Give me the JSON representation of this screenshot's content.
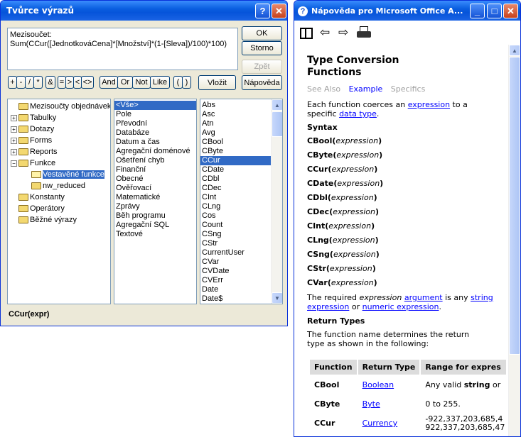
{
  "builder": {
    "title": "Tvůrce výrazů",
    "help_btn": "?",
    "close_btn": "✕",
    "expression_lines": [
      "Mezisoučet:",
      "Sum(CCur([JednotkováCena]*[Množství]*(1-[Sleva])/100)*100)"
    ],
    "ok": "OK",
    "cancel": "Storno",
    "undo": "Zpět",
    "operators": [
      "+",
      "-",
      "/",
      "*",
      "&",
      "=",
      ">",
      "<",
      "<>",
      "And",
      "Or",
      "Not",
      "Like",
      "(",
      ")"
    ],
    "insert": "Vložit",
    "help": "Nápověda",
    "folders": [
      {
        "label": "Mezisoučty objednávek",
        "indent": 0,
        "expander": "",
        "icon": "folder"
      },
      {
        "label": "Tabulky",
        "indent": 0,
        "expander": "+",
        "icon": "folder"
      },
      {
        "label": "Dotazy",
        "indent": 0,
        "expander": "+",
        "icon": "folder"
      },
      {
        "label": "Forms",
        "indent": 0,
        "expander": "+",
        "icon": "folder"
      },
      {
        "label": "Reports",
        "indent": 0,
        "expander": "+",
        "icon": "folder"
      },
      {
        "label": "Funkce",
        "indent": 0,
        "expander": "-",
        "icon": "folder"
      },
      {
        "label": "Vestavěné funkce",
        "indent": 1,
        "expander": "",
        "icon": "open-folder",
        "selected": true
      },
      {
        "label": "nw_reduced",
        "indent": 1,
        "expander": "",
        "icon": "folder"
      },
      {
        "label": "Konstanty",
        "indent": 0,
        "expander": "",
        "icon": "folder"
      },
      {
        "label": "Operátory",
        "indent": 0,
        "expander": "",
        "icon": "folder"
      },
      {
        "label": "Běžné výrazy",
        "indent": 0,
        "expander": "",
        "icon": "folder"
      }
    ],
    "categories": [
      "<Vše>",
      "Pole",
      "Převodní",
      "Databáze",
      "Datum a čas",
      "Agregační doménové",
      "Ošetření chyb",
      "Finanční",
      "Obecné",
      "Ověřovací",
      "Matematické",
      "Zprávy",
      "Běh programu",
      "Agregační SQL",
      "Textové"
    ],
    "category_selected": 0,
    "functions": [
      "Abs",
      "Asc",
      "Atn",
      "Avg",
      "CBool",
      "CByte",
      "CCur",
      "CDate",
      "CDbl",
      "CDec",
      "CInt",
      "CLng",
      "Cos",
      "Count",
      "CSng",
      "CStr",
      "CurrentUser",
      "CVar",
      "CVDate",
      "CVErr",
      "Date",
      "Date$"
    ],
    "function_selected": 6,
    "status": "CCur(expr)"
  },
  "help": {
    "title": "Nápověda pro Microsoft Office A...",
    "min_btn": "_",
    "max_btn": "□",
    "close_btn": "✕",
    "heading": [
      "Type Conversion",
      "Functions"
    ],
    "tabs": [
      "See Also",
      "Example",
      "Specifics"
    ],
    "intro_parts": [
      "Each function coerces an ",
      "expression",
      " to a specific ",
      "data type",
      "."
    ],
    "syntax_title": "Syntax",
    "syntax": [
      {
        "name": "CBool",
        "arg": "expression"
      },
      {
        "name": "CByte",
        "arg": "expression"
      },
      {
        "name": "CCur",
        "arg": "expression"
      },
      {
        "name": "CDate",
        "arg": "expression"
      },
      {
        "name": "CDbl",
        "arg": "expression"
      },
      {
        "name": "CDec",
        "arg": "expression"
      },
      {
        "name": "CInt",
        "arg": "expression"
      },
      {
        "name": "CLng",
        "arg": "expression"
      },
      {
        "name": "CSng",
        "arg": "expression"
      },
      {
        "name": "CStr",
        "arg": "expression"
      },
      {
        "name": "CVar",
        "arg": "expression"
      }
    ],
    "required_parts": [
      "The required ",
      "expression",
      " ",
      "argument",
      " is any ",
      "string expression",
      " or ",
      "numeric expression",
      "."
    ],
    "return_title": "Return Types",
    "return_text": "The function name determines the return type as shown in the following:",
    "table_headers": [
      "Function",
      "Return Type",
      "Range for expres"
    ],
    "table_rows": [
      {
        "fn": "CBool",
        "type": "Boolean",
        "range_pre": "Any valid ",
        "range_bold": "string",
        "range_post": " or"
      },
      {
        "fn": "CByte",
        "type": "Byte",
        "range_pre": "0 to 255.",
        "range_bold": "",
        "range_post": ""
      },
      {
        "fn": "CCur",
        "type": "Currency",
        "range_pre": "-922,337,203,685,4",
        "range_bold": "",
        "range_post": "",
        "range_line2": "922,337,203,685,47"
      }
    ]
  }
}
